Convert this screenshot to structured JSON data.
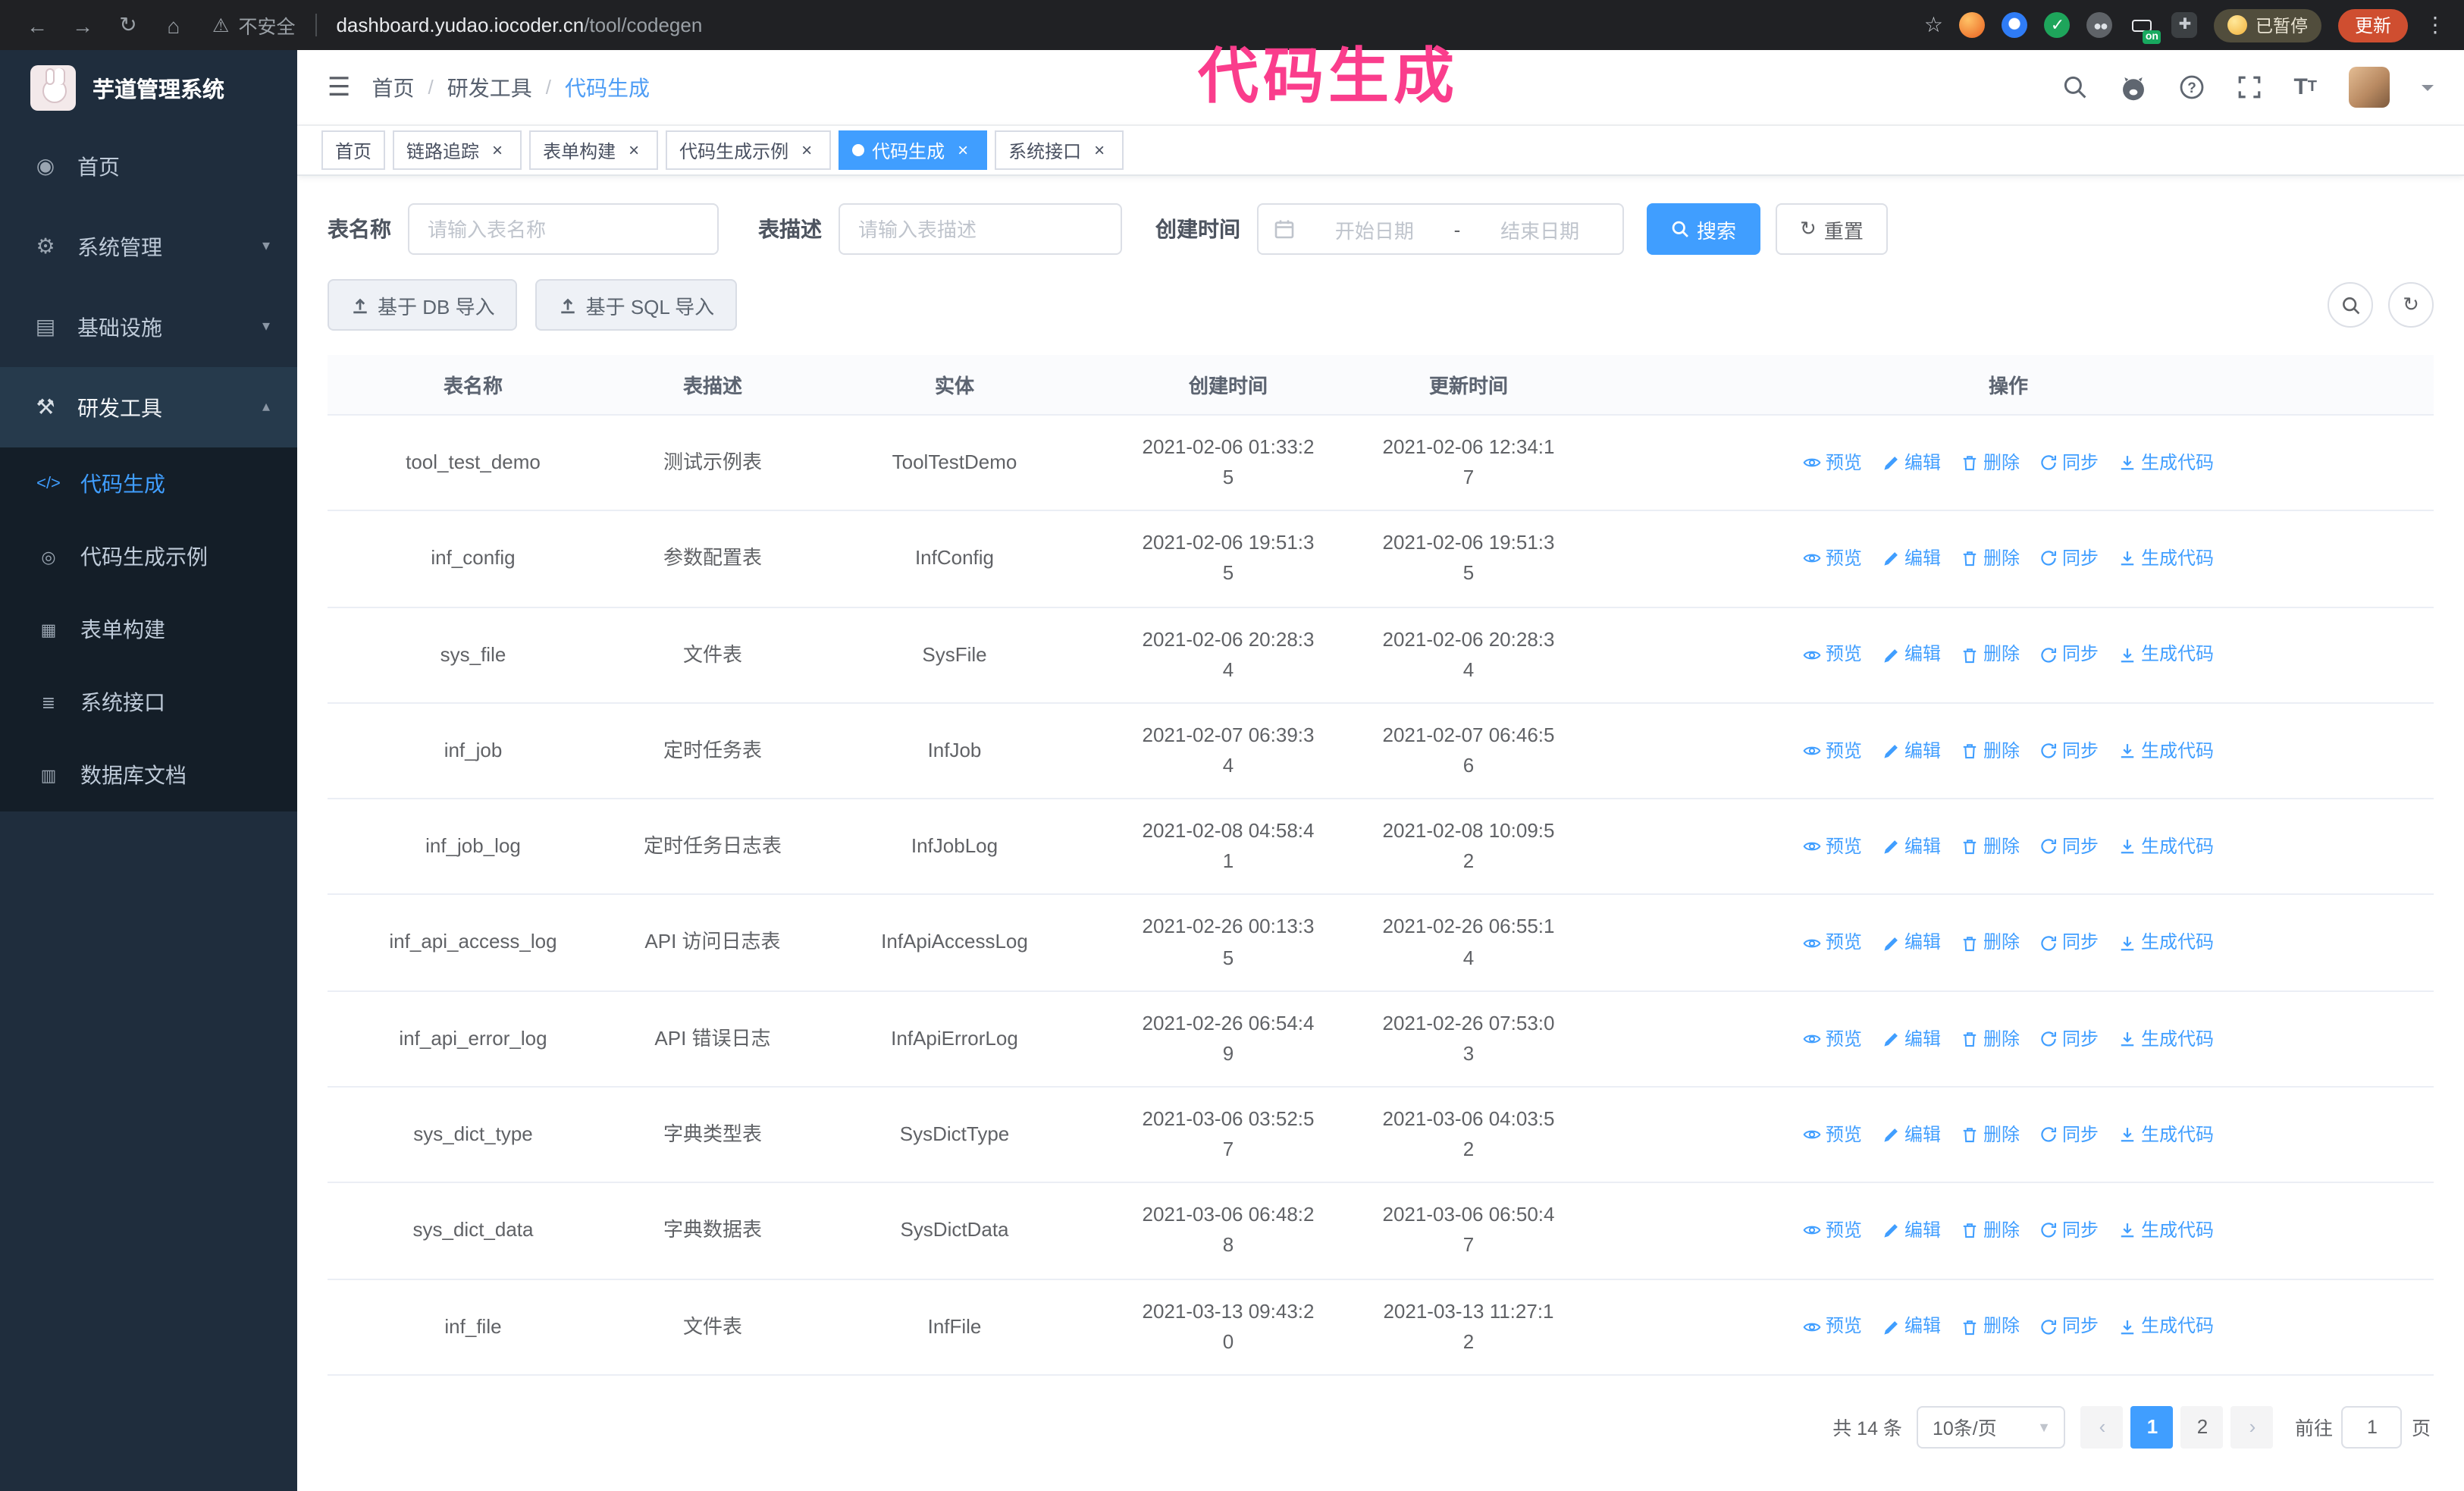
{
  "accent": {
    "primary": "#409eff",
    "overlay_pink": "#fa3d8c",
    "sidebar_bg": "#1f2d3d"
  },
  "browser": {
    "security_label": "不安全",
    "url_host": "dashboard.yudao.iocoder.cn",
    "url_path": "/tool/codegen",
    "on_badge": "on",
    "paused_label": "已暂停",
    "update_label": "更新"
  },
  "overlay": {
    "title": "代码生成"
  },
  "sidebar": {
    "logo_title": "芋道管理系统",
    "items": [
      {
        "label": "首页",
        "icon": "dashboard",
        "expandable": false,
        "expanded": false
      },
      {
        "label": "系统管理",
        "icon": "gear",
        "expandable": true,
        "expanded": false
      },
      {
        "label": "基础设施",
        "icon": "infra",
        "expandable": true,
        "expanded": false
      },
      {
        "label": "研发工具",
        "icon": "tools",
        "expandable": true,
        "expanded": true
      }
    ],
    "subitems": [
      {
        "label": "代码生成",
        "icon": "code",
        "active": true
      },
      {
        "label": "代码生成示例",
        "icon": "example",
        "active": false
      },
      {
        "label": "表单构建",
        "icon": "form",
        "active": false
      },
      {
        "label": "系统接口",
        "icon": "api",
        "active": false
      },
      {
        "label": "数据库文档",
        "icon": "db",
        "active": false
      }
    ]
  },
  "header": {
    "breadcrumb": [
      "首页",
      "研发工具",
      "代码生成"
    ]
  },
  "tabs": [
    {
      "label": "首页",
      "closable": false,
      "active": false
    },
    {
      "label": "链路追踪",
      "closable": true,
      "active": false
    },
    {
      "label": "表单构建",
      "closable": true,
      "active": false
    },
    {
      "label": "代码生成示例",
      "closable": true,
      "active": false
    },
    {
      "label": "代码生成",
      "closable": true,
      "active": true
    },
    {
      "label": "系统接口",
      "closable": true,
      "active": false
    }
  ],
  "filters": {
    "table_name_label": "表名称",
    "table_name_placeholder": "请输入表名称",
    "table_desc_label": "表描述",
    "table_desc_placeholder": "请输入表描述",
    "create_time_label": "创建时间",
    "date_start_placeholder": "开始日期",
    "date_separator": "-",
    "date_end_placeholder": "结束日期",
    "search_button": "搜索",
    "reset_button": "重置"
  },
  "toolbar": {
    "import_db_label": "基于 DB 导入",
    "import_sql_label": "基于 SQL 导入"
  },
  "table": {
    "columns": [
      "表名称",
      "表描述",
      "实体",
      "创建时间",
      "更新时间",
      "操作"
    ],
    "actions": [
      "预览",
      "编辑",
      "删除",
      "同步",
      "生成代码"
    ],
    "rows": [
      {
        "name": "tool_test_demo",
        "desc": "测试示例表",
        "entity": "ToolTestDemo",
        "created": "2021-02-06 01:33:25",
        "updated": "2021-02-06 12:34:17"
      },
      {
        "name": "inf_config",
        "desc": "参数配置表",
        "entity": "InfConfig",
        "created": "2021-02-06 19:51:35",
        "updated": "2021-02-06 19:51:35"
      },
      {
        "name": "sys_file",
        "desc": "文件表",
        "entity": "SysFile",
        "created": "2021-02-06 20:28:34",
        "updated": "2021-02-06 20:28:34"
      },
      {
        "name": "inf_job",
        "desc": "定时任务表",
        "entity": "InfJob",
        "created": "2021-02-07 06:39:34",
        "updated": "2021-02-07 06:46:56"
      },
      {
        "name": "inf_job_log",
        "desc": "定时任务日志表",
        "entity": "InfJobLog",
        "created": "2021-02-08 04:58:41",
        "updated": "2021-02-08 10:09:52"
      },
      {
        "name": "inf_api_access_log",
        "desc": "API 访问日志表",
        "entity": "InfApiAccessLog",
        "created": "2021-02-26 00:13:35",
        "updated": "2021-02-26 06:55:14"
      },
      {
        "name": "inf_api_error_log",
        "desc": "API 错误日志",
        "entity": "InfApiErrorLog",
        "created": "2021-02-26 06:54:49",
        "updated": "2021-02-26 07:53:03"
      },
      {
        "name": "sys_dict_type",
        "desc": "字典类型表",
        "entity": "SysDictType",
        "created": "2021-03-06 03:52:57",
        "updated": "2021-03-06 04:03:52"
      },
      {
        "name": "sys_dict_data",
        "desc": "字典数据表",
        "entity": "SysDictData",
        "created": "2021-03-06 06:48:28",
        "updated": "2021-03-06 06:50:47"
      },
      {
        "name": "inf_file",
        "desc": "文件表",
        "entity": "InfFile",
        "created": "2021-03-13 09:43:20",
        "updated": "2021-03-13 11:27:12"
      }
    ]
  },
  "pagination": {
    "total_label": "共 14 条",
    "page_size": "10条/页",
    "pages": [
      "1",
      "2"
    ],
    "current_page": "1",
    "goto_prefix": "前往",
    "goto_value": "1",
    "goto_suffix": "页"
  }
}
